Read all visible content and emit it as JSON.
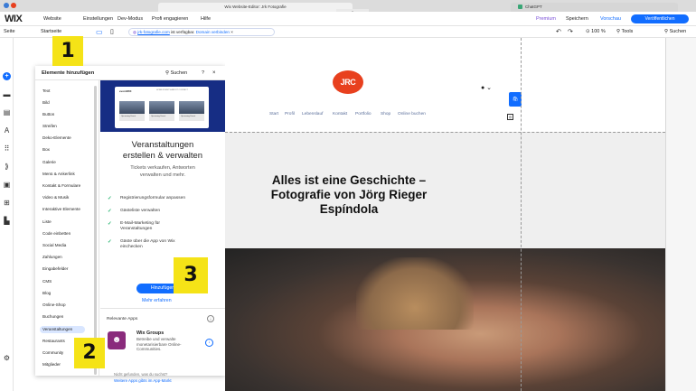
{
  "browser": {
    "active_tab": "Wix Website-Editor: Jrk Fotografie",
    "other_tab": "ChatGPT",
    "tab_scroll": "⌃"
  },
  "menubar": {
    "logo": "WIX",
    "items": [
      "Website",
      "Einstellungen",
      "Dev-Modus",
      "Profi engagieren",
      "Hilfe"
    ],
    "right": {
      "premium": "Premium",
      "save": "Speichern",
      "preview": "Vorschau",
      "publish": "Veröffentlichen"
    }
  },
  "toolbar2": {
    "page_label": "Seite",
    "page_value": "Startseite",
    "domain_link": "jrk-fotografie.com",
    "domain_text": "ist verfügbar.",
    "domain_connect": "Domain verbinden",
    "close": "×",
    "undo": "↶",
    "redo": "↷",
    "zoom": "100 %",
    "tools": "Tools",
    "search": "Suchen"
  },
  "rail": {
    "icons": [
      "add-icon",
      "sections-icon",
      "pages-icon",
      "design-icon",
      "apps-icon",
      "business-icon",
      "media-icon",
      "cms-icon",
      "market-icon",
      "settings-icon"
    ]
  },
  "panel": {
    "title": "Elemente hinzufügen",
    "search": "Suchen",
    "help": "?",
    "close": "×",
    "categories": [
      "Text",
      "Bild",
      "Button",
      "Streifen",
      "Deko-Elemente",
      "Box",
      "Galerie",
      "Menü & Ankerlink",
      "Kontakt & Formulare",
      "Video & Musik",
      "Interaktive Elemente",
      "Liste",
      "Code einbetten",
      "Social Media",
      "Zahlungen",
      "Eingabefelder",
      "CMS",
      "Blog",
      "Online-Shop",
      "Buchungen",
      "Veranstaltungen",
      "Restaurants",
      "Community",
      "Mitglieder"
    ],
    "selected_index": 20,
    "promo": {
      "mock_logo": "eventWIX",
      "mock_nav": "HOME  EVENTS  ABOUT  CONTACT",
      "mock_cards": [
        "Upcoming Event",
        "Upcoming Event",
        "Upcoming Event"
      ],
      "title_line1": "Veranstaltungen",
      "title_line2": "erstellen & verwalten",
      "subtitle_line1": "Tickets verkaufen, Antworten",
      "subtitle_line2": "verwalten und mehr.",
      "features": [
        "Registrierungsformular anpassen",
        "Gästeliste verwalten",
        "E-Mail-Marketing für Veranstaltungen",
        "Gäste über die App von Wix einchecken"
      ],
      "add_button": "Hinzufügen",
      "more_link": "Mehr erfahren"
    },
    "related": {
      "title": "Relevante Apps",
      "app_name": "Wix Groups",
      "app_desc": "Betreibe und verwalte monetarisierbare Online-Communities.",
      "not_found": "Nicht gefunden, was du suchst?",
      "more_apps": "Weitere Apps gibts im App-Markt"
    }
  },
  "site": {
    "logo": "JRC",
    "nav": [
      "Start",
      "Profil",
      "Lebenslauf",
      "Kontakt",
      "Portfolio",
      "Shop",
      "Online buchen"
    ],
    "hero_line1": "Alles ist eine Geschichte –",
    "hero_line2": "Fotografie von Jörg Rieger",
    "hero_line3": "Espíndola"
  },
  "badges": [
    "1",
    "2",
    "3"
  ],
  "colors": {
    "accent": "#116dff",
    "badge": "#f5e317",
    "logo": "#e8401e"
  }
}
